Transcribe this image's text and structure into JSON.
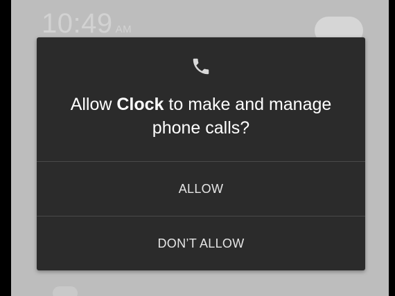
{
  "background": {
    "clock_time": "10:49",
    "clock_ampm": "AM"
  },
  "dialog": {
    "icon": "phone-icon",
    "message_prefix": "Allow ",
    "app_name": "Clock",
    "message_suffix": " to make and manage phone calls?",
    "allow_label": "ALLOW",
    "deny_label": "DON’T ALLOW"
  },
  "colors": {
    "scrim": "#bdbdbd",
    "dialog_bg": "#2b2b2b",
    "text": "#ffffff",
    "button_text": "#e6e6e6"
  }
}
